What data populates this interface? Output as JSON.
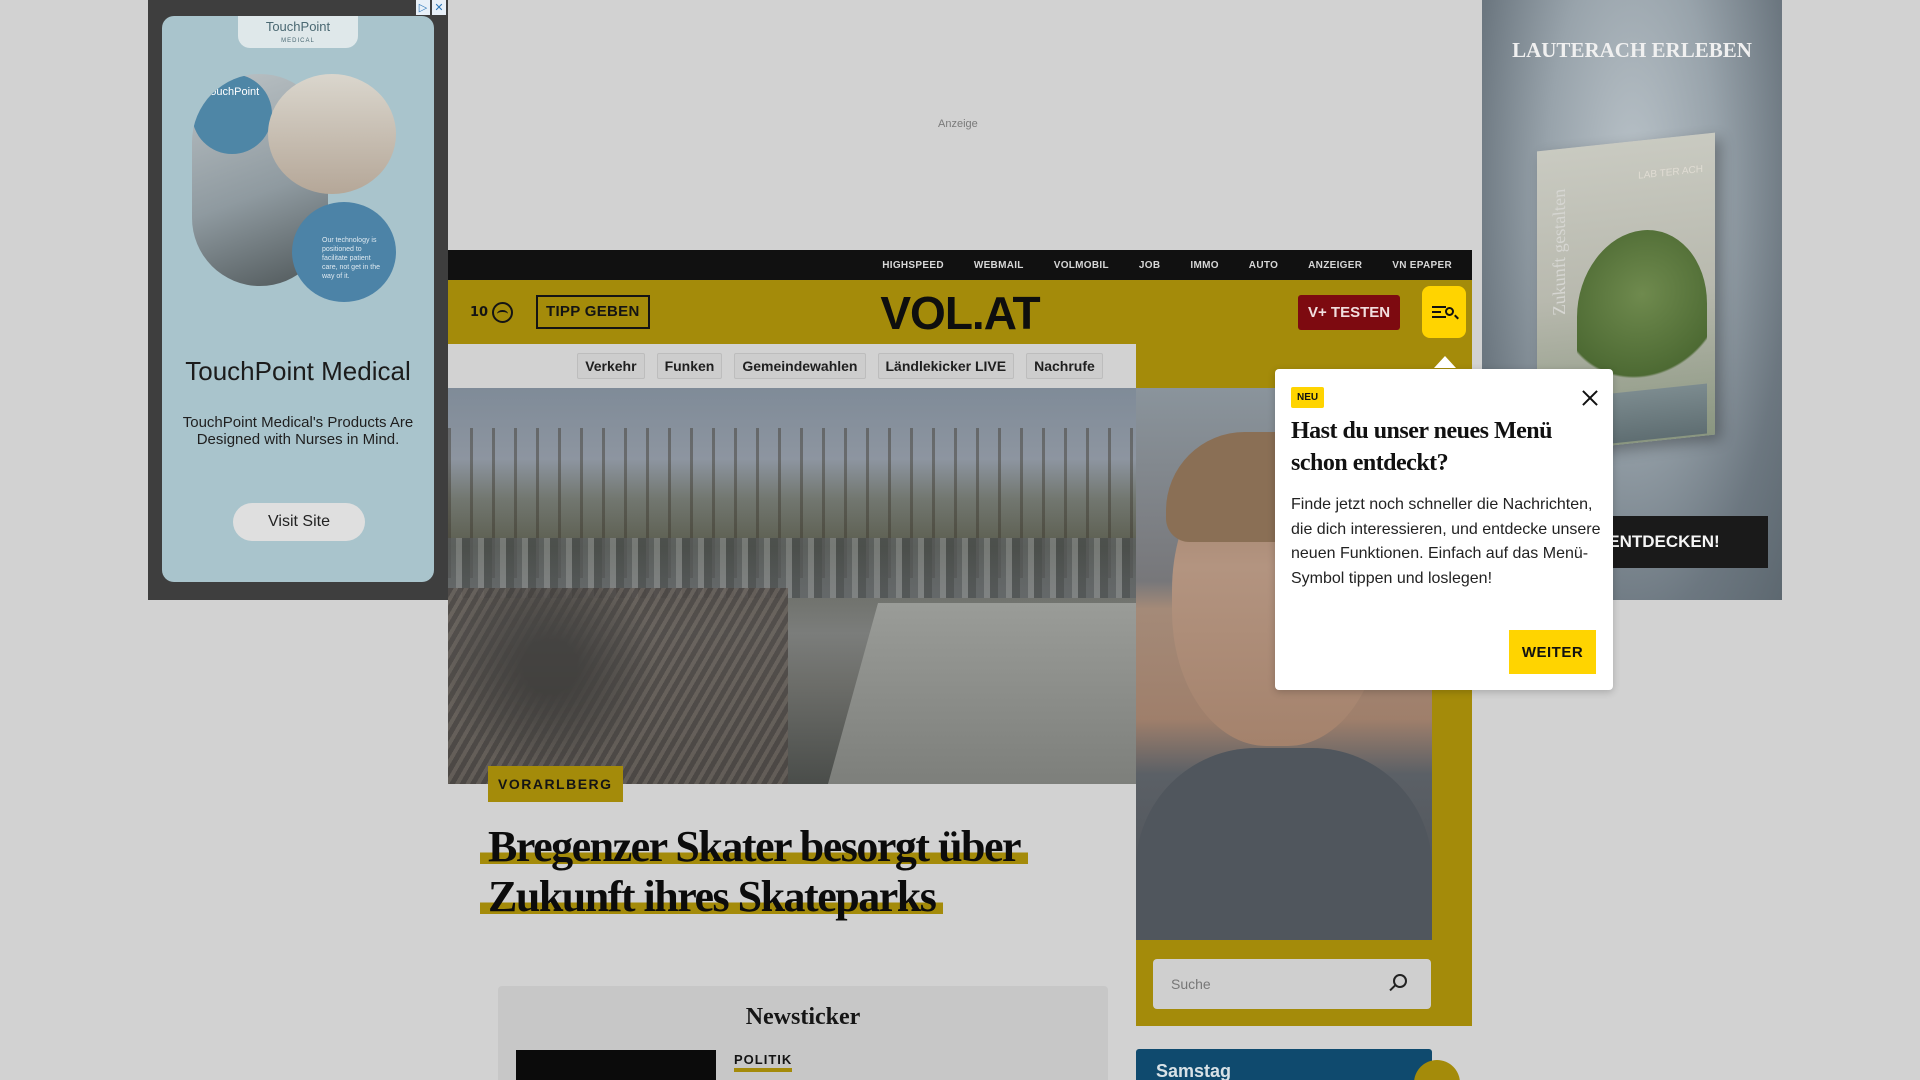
{
  "left_ad": {
    "adchoices": [
      "▷",
      "✕"
    ],
    "logo_top": "TouchPoint",
    "logo_top_sub": "MEDICAL",
    "circle_logo": "TouchPoint",
    "circle_text": "Our technology is positioned to facilitate patient care, not get in the way of it.",
    "brand_name": "TouchPoint Medical",
    "description": "TouchPoint Medical's Products Are Designed with Nurses in Mind.",
    "cta": "Visit Site"
  },
  "center_ad": {
    "label": "Anzeige"
  },
  "right_ad": {
    "title": "LAUTERACH ERLEBEN",
    "book_spine": "Zukunft gestalten",
    "book_brand": "LAB TER ACH",
    "cta": "ENTDECKEN!"
  },
  "topnav": [
    "HIGHSPEED",
    "WEBMAIL",
    "VOLMOBIL",
    "JOB",
    "IMMO",
    "AUTO",
    "ANZEIGER",
    "VN EPAPER"
  ],
  "header": {
    "temperature": "10",
    "tipp_label": "TIPP GEBEN",
    "logo": "VOL.AT",
    "vplus_label": "V+ TESTEN",
    "menu_icon": "menu-search-icon"
  },
  "subnav": [
    "Verkehr",
    "Funken",
    "Gemeindewahlen",
    "Ländlekicker LIVE",
    "Nachrufe"
  ],
  "hero": {
    "category": "VORARLBERG",
    "headline": "Bregenzer Skater besorgt über Zukunft ihres Skateparks"
  },
  "search": {
    "placeholder": "Suche"
  },
  "weather_box": {
    "day": "Samstag"
  },
  "newsticker": {
    "title": "Newsticker",
    "first_category": "POLITIK"
  },
  "popup": {
    "badge": "NEU",
    "title": "Hast du unser neues Menü schon entdeckt?",
    "body": "Finde jetzt noch schneller die Nachrichten, die dich interessieren, und entdecke unsere neuen Funktionen. Einfach auf das Menü-Symbol tippen und loslegen!",
    "button": "WEITER"
  },
  "colors": {
    "brand_yellow": "#ffd400",
    "brand_yellow_dimmed": "#a48b0a",
    "vplus_red": "#7d0a10"
  }
}
